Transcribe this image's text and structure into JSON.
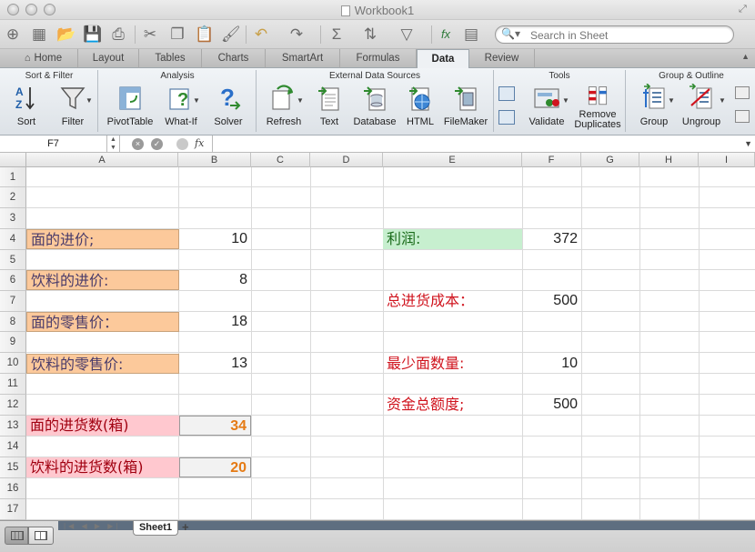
{
  "window": {
    "title": "Workbook1"
  },
  "search": {
    "placeholder": "Search in Sheet"
  },
  "tabs": [
    "Home",
    "Layout",
    "Tables",
    "Charts",
    "SmartArt",
    "Formulas",
    "Data",
    "Review"
  ],
  "active_tab": "Data",
  "ribbon": {
    "groups": {
      "sort_filter": "Sort & Filter",
      "analysis": "Analysis",
      "external": "External Data Sources",
      "tools": "Tools",
      "group_outline": "Group & Outline"
    },
    "buttons": {
      "sort": "Sort",
      "filter": "Filter",
      "pivottable": "PivotTable",
      "whatif": "What-If",
      "solver": "Solver",
      "refresh": "Refresh",
      "text": "Text",
      "database": "Database",
      "html": "HTML",
      "filemaker": "FileMaker",
      "validate": "Validate",
      "remove_dup_1": "Remove",
      "remove_dup_2": "Duplicates",
      "group": "Group",
      "ungroup": "Ungroup"
    }
  },
  "formula_bar": {
    "name_box": "F7",
    "fx": "fx",
    "formula": ""
  },
  "grid": {
    "columns": [
      "A",
      "B",
      "C",
      "D",
      "E",
      "F",
      "G",
      "H",
      "I"
    ],
    "rows": [
      "1",
      "2",
      "3",
      "4",
      "5",
      "6",
      "7",
      "8",
      "9",
      "10",
      "11",
      "12",
      "13",
      "14",
      "15",
      "16",
      "17"
    ],
    "cells": {
      "A4": "面的进价;",
      "B4": "10",
      "A6": "饮料的进价:",
      "B6": "8",
      "A8": "面的零售价：",
      "B8": "18",
      "A10": "饮料的零售价:",
      "B10": "13",
      "A13": "面的进货数(箱)",
      "B13": "34",
      "A15": "饮料的进货数(箱)",
      "B15": "20",
      "E4": "利润:",
      "F4": "372",
      "E7": "总进货成本：",
      "F7": "500",
      "E10": "最少面数量:",
      "F10": "10",
      "E12": "资金总额度;",
      "F12": "500"
    }
  },
  "sheets": {
    "active": "Sheet1",
    "add": "+"
  },
  "colors": {
    "label_orange": "#fcc99b",
    "label_pink": "#ffc8cf",
    "label_green": "#c7efcf",
    "result_red": "#d0141e",
    "input_orange": "#e57a14"
  }
}
